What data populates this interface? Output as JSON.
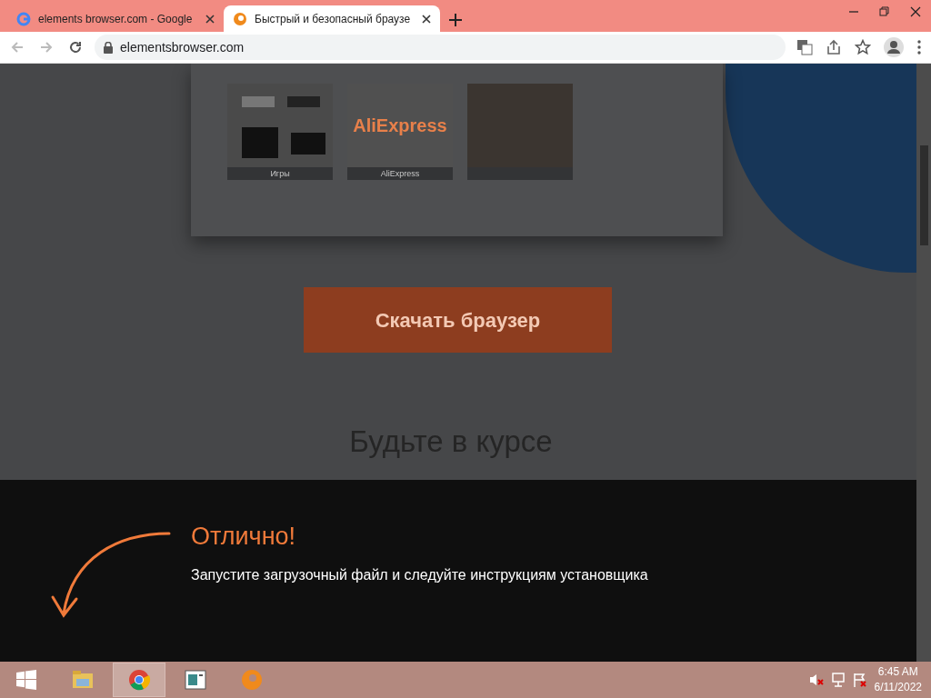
{
  "tabs": [
    {
      "title": "elements browser.com - Google",
      "selected": false
    },
    {
      "title": "Быстрый и безопасный браузе",
      "selected": true
    }
  ],
  "address_bar": {
    "url": "elementsbrowser.com"
  },
  "page": {
    "tiles": [
      {
        "kind": "games",
        "label": "Игры"
      },
      {
        "kind": "aliexpress",
        "logo": "AliExpress",
        "label": "AliExpress"
      },
      {
        "kind": "photo"
      }
    ],
    "download_button": "Скачать браузер",
    "heading": "Будьте в курсе"
  },
  "notice": {
    "title": "Отлично!",
    "message": "Запустите загрузочный файл и следуйте инструкциям установщика"
  },
  "taskbar": {
    "apps": [
      {
        "kind": "explorer",
        "selected": false
      },
      {
        "kind": "chrome",
        "selected": true
      },
      {
        "kind": "window",
        "selected": false
      },
      {
        "kind": "elements",
        "selected": false
      }
    ],
    "time": "6:45 AM",
    "date": "6/11/2022"
  }
}
